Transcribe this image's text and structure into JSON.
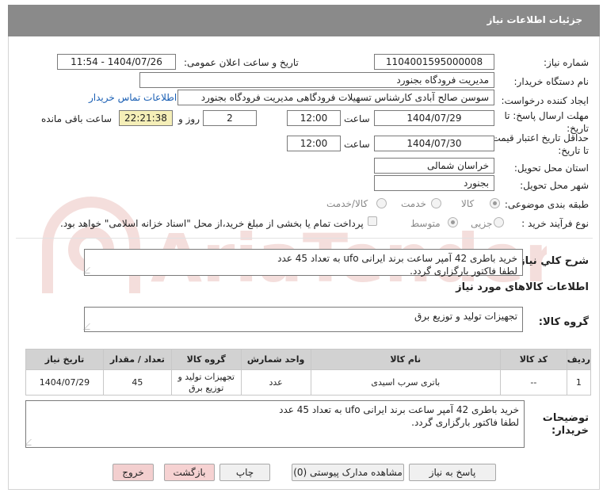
{
  "title": "جزئیات اطلاعات نیاز",
  "labels": {
    "need_number": "شماره نیاز:",
    "announce_datetime": "تاریخ و ساعت اعلان عمومی:",
    "buyer_org": "نام دستگاه خریدار:",
    "requester": "ایجاد کننده درخواست:",
    "reply_deadline": "مهلت ارسال پاسخ: تا تاریخ:",
    "time_word": "ساعت",
    "days_and": "روز و",
    "remaining": "ساعت باقی مانده",
    "price_validity": "حداقل تاریخ اعتبار قیمت: تا تاریخ:",
    "delivery_province": "استان محل تحویل:",
    "delivery_city": "شهر محل تحویل:",
    "category": "طبقه بندی موضوعی:",
    "process_type": "نوع فرآیند خرید :",
    "general_desc": "شرح کلي نياز:",
    "goods_info": "اطلاعات کالاهای مورد نیاز",
    "goods_group": "گروه کالا:",
    "buyer_notes": "توضیحات خریدار:"
  },
  "fields": {
    "need_number": "1104001595000008",
    "announce_datetime": "1404/07/26 - 11:54",
    "buyer_org": "مدیریت فرودگاه بجنورد",
    "requester": "سوسن صالح آبادی کارشناس تسهیلات فرودگاهی مدیریت فرودگاه بجنورد",
    "contact_link": "اطلاعات تماس خریدار",
    "reply_date": "1404/07/29",
    "reply_time": "12:00",
    "reply_days": "2",
    "reply_remaining": "22:21:38",
    "validity_date": "1404/07/30",
    "validity_time": "12:00",
    "province": "خراسان شمالی",
    "city": "بجنورد"
  },
  "category_options": [
    {
      "label": "کالا",
      "selected": true
    },
    {
      "label": "خدمت",
      "selected": false
    },
    {
      "label": "کالا/خدمت",
      "selected": false
    }
  ],
  "process_options": [
    {
      "label": "جزیی",
      "selected": false
    },
    {
      "label": "متوسط",
      "selected": true
    }
  ],
  "payment_note": "پرداخت تمام یا بخشی از مبلغ خرید،از محل \"اسناد خزانه اسلامی\" خواهد بود.",
  "general_desc_lines": [
    "خرید باطری 42 آمپر ساعت برند ایرانی ufo به تعداد 45 عدد",
    "لطفا فاکتور بارگزاری گردد."
  ],
  "goods_group_value": "تجهیزات تولید و توزیع برق",
  "table": {
    "headers": [
      "ردیف",
      "کد کالا",
      "نام کالا",
      "واحد شمارش",
      "گروه کالا",
      "تعداد / مقدار",
      "تاریخ نیاز"
    ],
    "rows": [
      [
        "1",
        "--",
        "باتری سرب اسیدی",
        "عدد",
        "تجهیزات تولید و توزیع برق",
        "45",
        "1404/07/29"
      ]
    ]
  },
  "buyer_notes_lines": [
    "خرید باطری 42 آمپر ساعت برند ایرانی ufo به تعداد 45 عدد",
    "لطفا فاکتور بارگزاری گردد."
  ],
  "buttons": {
    "reply": "پاسخ به نیاز",
    "view_docs": "مشاهده مدارک پیوستی (0)",
    "print": "چاپ",
    "back": "بازگشت",
    "exit": "خروج"
  },
  "watermark_text": "AriaTender.neT",
  "colors": {
    "title_bar": "#8a8a8a",
    "table_header": "#d2d2d2",
    "remaining_bg": "#f5efb8",
    "link": "#1a5fb4",
    "watermark": "#c0392b"
  }
}
